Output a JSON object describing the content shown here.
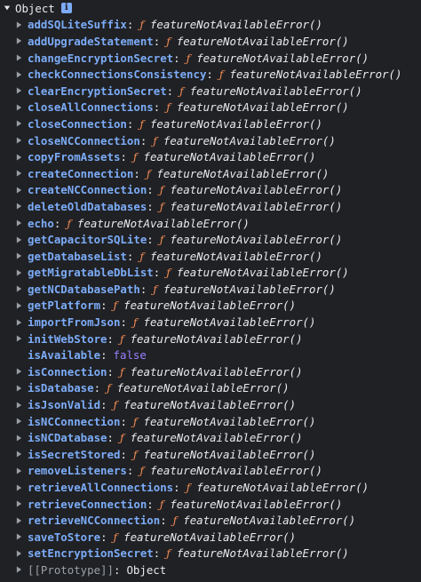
{
  "header": {
    "label": "Object",
    "info_badge": "i"
  },
  "colors": {
    "background": "#202124",
    "key": "#7cacf8",
    "function_tag": "#f28b54",
    "boolean": "#9980ff",
    "text": "#e8eaed",
    "muted": "#9aa0a6"
  },
  "function_tag": "ƒ",
  "function_value": "featureNotAvailableError()",
  "properties": [
    {
      "key": "addSQLiteSuffix"
    },
    {
      "key": "addUpgradeStatement"
    },
    {
      "key": "changeEncryptionSecret"
    },
    {
      "key": "checkConnectionsConsistency"
    },
    {
      "key": "clearEncryptionSecret"
    },
    {
      "key": "closeAllConnections"
    },
    {
      "key": "closeConnection"
    },
    {
      "key": "closeNCConnection"
    },
    {
      "key": "copyFromAssets"
    },
    {
      "key": "createConnection"
    },
    {
      "key": "createNCConnection"
    },
    {
      "key": "deleteOldDatabases"
    },
    {
      "key": "echo"
    },
    {
      "key": "getCapacitorSQLite"
    },
    {
      "key": "getDatabaseList"
    },
    {
      "key": "getMigratableDbList"
    },
    {
      "key": "getNCDatabasePath"
    },
    {
      "key": "getPlatform"
    },
    {
      "key": "importFromJson"
    },
    {
      "key": "initWebStore"
    },
    {
      "key": "isAvailable",
      "value": "false",
      "type": "boolean"
    },
    {
      "key": "isConnection"
    },
    {
      "key": "isDatabase"
    },
    {
      "key": "isJsonValid"
    },
    {
      "key": "isNCConnection"
    },
    {
      "key": "isNCDatabase"
    },
    {
      "key": "isSecretStored"
    },
    {
      "key": "removeListeners"
    },
    {
      "key": "retrieveAllConnections"
    },
    {
      "key": "retrieveConnection"
    },
    {
      "key": "retrieveNCConnection"
    },
    {
      "key": "saveToStore"
    },
    {
      "key": "setEncryptionSecret"
    }
  ],
  "prototype": {
    "key": "[[Prototype]]",
    "value": "Object"
  }
}
